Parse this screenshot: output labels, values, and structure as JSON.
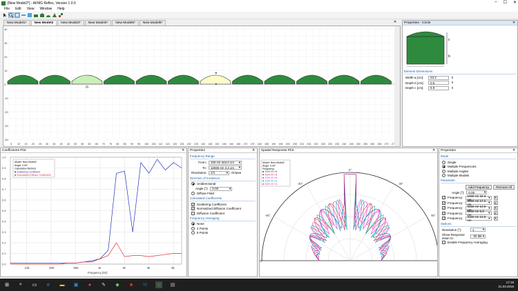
{
  "window": {
    "title": "[New Model2*] - AFMG Reflex, Version 1.0.0",
    "buttons": [
      "–",
      "☐",
      "✕"
    ]
  },
  "menu": [
    "File",
    "Edit",
    "View",
    "Window",
    "Help"
  ],
  "toolbar": {
    "icons": [
      "cursor-icon",
      "zoom-icon",
      "select-icon",
      "measure-icon",
      "view-icon",
      "shape-a-icon",
      "shape-b-icon",
      "shape-c-icon",
      "shape-d-icon",
      "tool-icon"
    ]
  },
  "tabs": [
    "New Model1*",
    "New Model2",
    "New Model3*",
    "New Model4*",
    "New Model5*",
    "New Model6*"
  ],
  "main": {
    "y_ticks": [
      "40",
      "30",
      "20",
      "10",
      "0",
      "-10",
      "-20",
      "-30",
      "-40"
    ],
    "x_ticks": [
      "5",
      "10",
      "15",
      "20",
      "25",
      "30",
      "35",
      "40",
      "45",
      "50",
      "55",
      "60",
      "65",
      "70",
      "75",
      "80",
      "85",
      "90",
      "95",
      "100",
      "105",
      "110",
      "115",
      "120",
      "125",
      "130",
      "135",
      "140",
      "145",
      "150",
      "155",
      "160",
      "165",
      "170",
      "175",
      "180",
      "185",
      "190",
      "195",
      "200",
      "205",
      "210",
      "215",
      "220",
      "225",
      "230",
      "235",
      "240",
      "245",
      "250",
      "255",
      "260",
      "265",
      "270",
      "275"
    ]
  },
  "props_circle": {
    "title": "Properties - Circle",
    "section": "Element Dimensions",
    "labels": {
      "a": "a",
      "b": "b",
      "c": "c"
    },
    "width_label": "Width a [cm]:",
    "width_val": "23.2",
    "depth_b_label": "Depth b [cm]:",
    "depth_b_val": "0.5",
    "depth_c_label": "Depth c [cm]:",
    "depth_c_val": "6.9"
  },
  "coeff": {
    "title": "Coefficients Plot",
    "legend": [
      "Model:    New Model2",
      "Angle:     0.00°",
      "Calculation Method",
      "■ Scattering Coefficient",
      "■ Normalized Diffusor Coefficient"
    ],
    "y_ticks": [
      "1.0",
      "0.9",
      "0.8",
      "0.7",
      "0.6",
      "0.5",
      "0.4",
      "0.3",
      "0.2",
      "0.1",
      "0.0"
    ],
    "x_ticks": [
      "125",
      "250",
      "500",
      "1k",
      "2k",
      "4k",
      "8k"
    ],
    "xlabel": "Frequency [Hz]"
  },
  "chart_data": [
    {
      "type": "line",
      "x": [
        "80",
        "100",
        "125",
        "160",
        "200",
        "250",
        "315",
        "400",
        "500",
        "630",
        "800",
        "1k",
        "1.25k",
        "1.6k",
        "2k",
        "2.5k",
        "3.15k",
        "4k",
        "5k",
        "6.3k",
        "8k",
        "10k"
      ],
      "series": [
        {
          "name": "Scattering Coefficient",
          "values": [
            0.01,
            0.01,
            0.01,
            0.01,
            0.01,
            0.01,
            0.01,
            0.01,
            0.01,
            0.02,
            0.03,
            0.05,
            0.13,
            0.85,
            0.87,
            0.3,
            0.95,
            0.85,
            0.98,
            0.88,
            0.95,
            0.9
          ]
        },
        {
          "name": "Normalized Diffusor Coefficient",
          "values": [
            0.0,
            0.0,
            0.0,
            0.0,
            0.0,
            0.0,
            0.0,
            0.01,
            0.01,
            0.02,
            0.02,
            0.05,
            0.08,
            0.2,
            0.07,
            0.08,
            0.08,
            0.07,
            0.08,
            0.09,
            0.1,
            0.1
          ]
        }
      ],
      "ylim": [
        0,
        1
      ],
      "xlabel": "Frequency [Hz]"
    }
  ],
  "freq_props": {
    "title": "Properties",
    "range": "Frequency Range",
    "from_label": "From:",
    "from_val": "100 Hz   343.0 cm",
    "to_label": "To:",
    "to_val": "10000 Hz   3.4 cm",
    "res_label": "Resolution:",
    "res_val": "1/1",
    "res_unit": "Octave",
    "doi": "Direction of Incidence",
    "uni": "Unidirectional",
    "angle_label": "Angle [°]:",
    "angle_val": "0.00",
    "diffuse": "Diffuse Field",
    "calc": "Calculated Coefficients",
    "c1": "Scattering Coefficient",
    "c2": "Normalized Diffusion Coefficient",
    "c3": "Diffusion Coefficient",
    "avg": "Frequency Averaging",
    "a1": "None",
    "a2": "4 Points",
    "a3": "8 Points"
  },
  "polar": {
    "title": "Spatial Response Plot",
    "legend": [
      "Model:    New Model2",
      "Angle:     0.00°",
      "Frequency",
      "■ 1000.00 Hz",
      "■ 2000.00 Hz",
      "■ 3150.00 Hz",
      "■ 3150.00 Hz",
      "■ 5000.00 Hz"
    ],
    "angles": [
      "0°",
      "-30°",
      "30°",
      "-60°",
      "60°",
      "-90°",
      "90°"
    ],
    "colors": [
      "#1f3fbf",
      "#c0392b",
      "#d63cd6",
      "#00b5b5",
      "#ff3aa0"
    ]
  },
  "mode_props": {
    "title": "Properties",
    "mode": "Mode",
    "m1": "Single",
    "m2": "Multiple Frequencies",
    "m3": "Multiple Angles",
    "m4": "Multiple Models",
    "param": "Parameter",
    "add": "Add Frequency",
    "remove": "Remove All",
    "angle_label": "Angle [°]:",
    "angle_val": "0.00",
    "freq_label": "Frequency:",
    "freqs": [
      "1000 Hz   34.3 cm",
      "2000 Hz   17.2 cm",
      "3150 Hz   10.9 cm",
      "5000 Hz   6.9 cm",
      "3150 Hz   10.9 cm"
    ],
    "options": "Options",
    "res_label": "Resolution [°]:",
    "res_val": "1",
    "show_label": "Show Response down to:",
    "show_val": "-30 dB",
    "enable": "Enable Frequency Averaging"
  },
  "taskbar": {
    "time": "17:18",
    "date": "21.03.2016"
  }
}
